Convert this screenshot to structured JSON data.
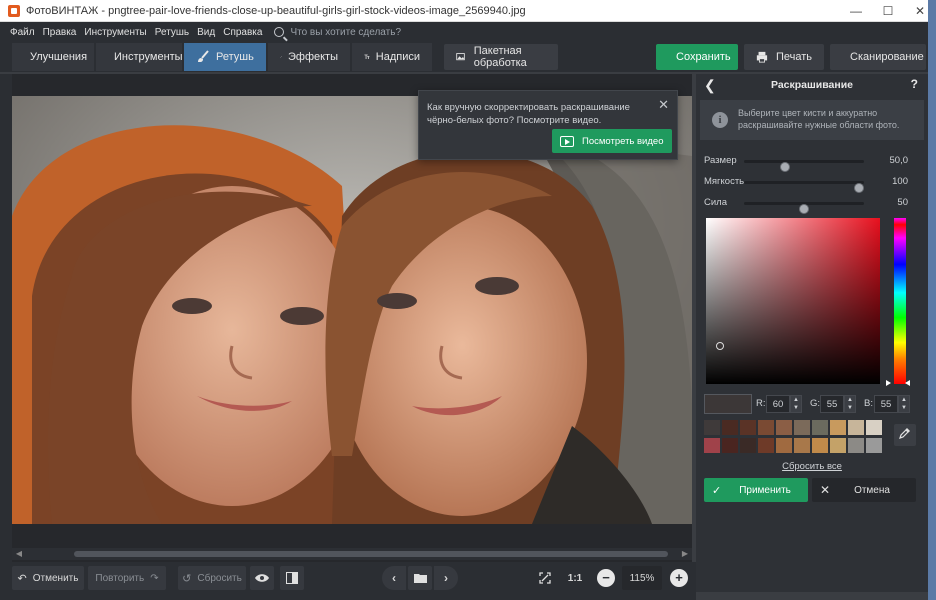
{
  "window": {
    "title": "ФотоВИНТАЖ - pngtree-pair-love-friends-close-up-beautiful-girls-girl-stock-videos-image_2569940.jpg",
    "minimize": "—",
    "maximize": "☐",
    "close": "✕"
  },
  "menu": {
    "items": [
      "Файл",
      "Правка",
      "Инструменты",
      "Ретушь",
      "Вид",
      "Справка"
    ],
    "search_placeholder": "Что вы хотите сделать?"
  },
  "toolbar": {
    "tabs": [
      {
        "label": "Улучшения",
        "icon": "sliders-icon"
      },
      {
        "label": "Инструменты",
        "icon": "crop-icon"
      },
      {
        "label": "Ретушь",
        "icon": "brush-icon",
        "active": true
      },
      {
        "label": "Эффекты",
        "icon": "magic-wand-icon"
      },
      {
        "label": "Надписи",
        "icon": "text-icon"
      }
    ],
    "batch_label": "Пакетная обработка",
    "save_label": "Сохранить",
    "print_label": "Печать",
    "scan_label": "Сканирование"
  },
  "hint": {
    "text": "Как вручную скорректировать раскрашивание чёрно-белых фото? Посмотрите видео.",
    "close": "✕",
    "button_label": "Посмотреть видео"
  },
  "bottom": {
    "undo_label": "Отменить",
    "redo_label": "Повторить",
    "reset_label": "Сбросить",
    "ratio_label": "1:1",
    "zoom_value": "115%",
    "minus": "−",
    "plus": "+"
  },
  "panel": {
    "title": "Раскрашивание",
    "back": "❮",
    "help": "?",
    "info_icon": "i",
    "info_text": "Выберите цвет кисти и аккуратно раскрашивайте нужные области фото.",
    "sliders": [
      {
        "label": "Размер",
        "value": "50,0",
        "fraction": 0.33
      },
      {
        "label": "Мягкость",
        "value": "100",
        "fraction": 1.0
      },
      {
        "label": "Сила",
        "value": "50",
        "fraction": 0.5
      }
    ],
    "rgb": {
      "r_label": "R:",
      "r": "60",
      "g_label": "G:",
      "g": "55",
      "b_label": "B:",
      "b": "55"
    },
    "swatch_color": "#3c3737",
    "palette": [
      "#3f3a3a",
      "#4a2a22",
      "#5a3326",
      "#7a4a33",
      "#8b5e45",
      "#7b6a5a",
      "#6b6b5e",
      "#c89a5e",
      "#c7b59a",
      "#d8d0c4",
      "#a0424a",
      "#4a2520",
      "#3a2a26",
      "#6e3a28",
      "#a06a40",
      "#a8784a",
      "#c08a4a",
      "#c4a268",
      "#8c8a86",
      "#9a9a9a"
    ],
    "reset_all": "Сбросить все",
    "apply_label": "Применить",
    "cancel_label": "Отмена"
  },
  "colors": {
    "accent_green": "#1f9a5e",
    "active_tab": "#3e6f9e",
    "panel_bg": "#2e3136"
  }
}
